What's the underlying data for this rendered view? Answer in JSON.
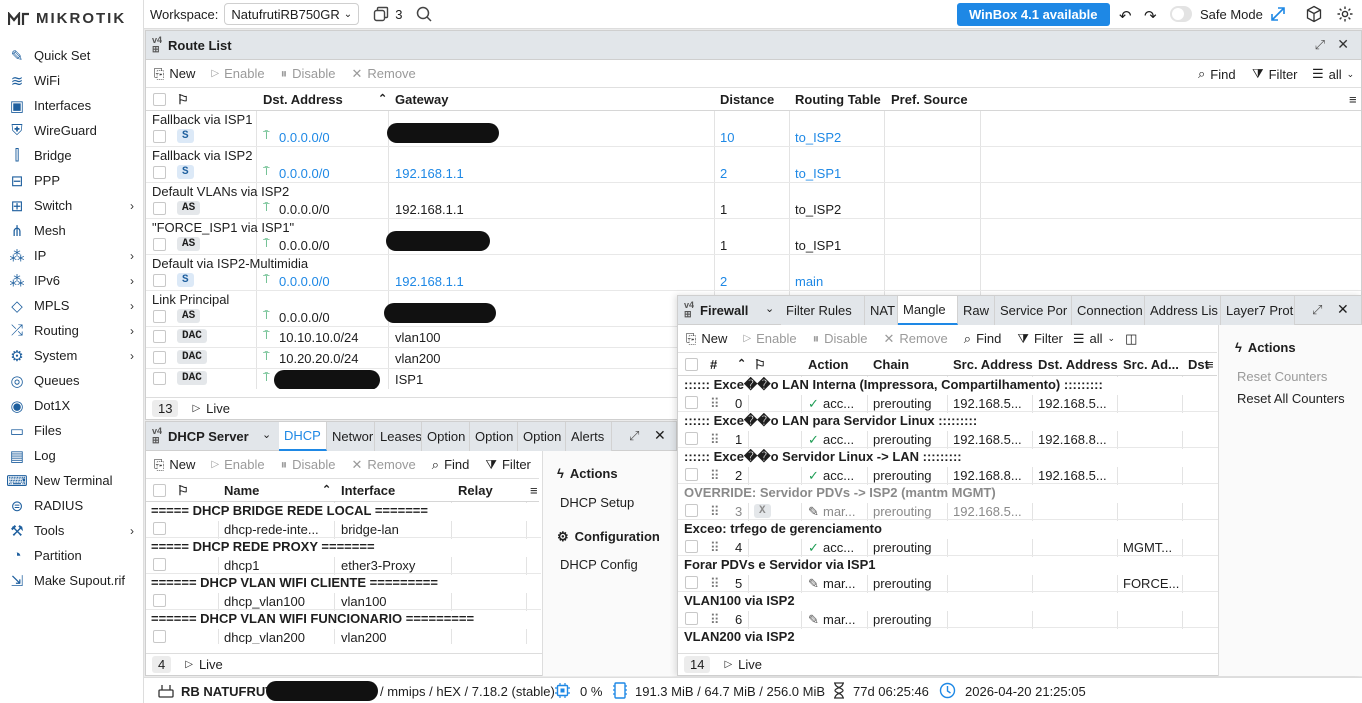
{
  "brand": {
    "logo_text": "MIKROTIK"
  },
  "sidebar": {
    "items": [
      {
        "label": "Quick Set",
        "icon": "quickset-icon",
        "arrow": false
      },
      {
        "label": "WiFi",
        "icon": "wifi-icon",
        "arrow": false
      },
      {
        "label": "Interfaces",
        "icon": "interfaces-icon",
        "arrow": false
      },
      {
        "label": "WireGuard",
        "icon": "wireguard-icon",
        "arrow": false
      },
      {
        "label": "Bridge",
        "icon": "bridge-icon",
        "arrow": false
      },
      {
        "label": "PPP",
        "icon": "ppp-icon",
        "arrow": false
      },
      {
        "label": "Switch",
        "icon": "switch-icon",
        "arrow": true
      },
      {
        "label": "Mesh",
        "icon": "mesh-icon",
        "arrow": false
      },
      {
        "label": "IP",
        "icon": "ip-icon",
        "arrow": true
      },
      {
        "label": "IPv6",
        "icon": "ipv6-icon",
        "arrow": true
      },
      {
        "label": "MPLS",
        "icon": "mpls-icon",
        "arrow": true
      },
      {
        "label": "Routing",
        "icon": "routing-icon",
        "arrow": true
      },
      {
        "label": "System",
        "icon": "system-icon",
        "arrow": true
      },
      {
        "label": "Queues",
        "icon": "queues-icon",
        "arrow": false
      },
      {
        "label": "Dot1X",
        "icon": "dot1x-icon",
        "arrow": false
      },
      {
        "label": "Files",
        "icon": "files-icon",
        "arrow": false
      },
      {
        "label": "Log",
        "icon": "log-icon",
        "arrow": false
      },
      {
        "label": "New Terminal",
        "icon": "terminal-icon",
        "arrow": false
      },
      {
        "label": "RADIUS",
        "icon": "radius-icon",
        "arrow": false
      },
      {
        "label": "Tools",
        "icon": "tools-icon",
        "arrow": true
      },
      {
        "label": "Partition",
        "icon": "partition-icon",
        "arrow": false
      },
      {
        "label": "Make Supout.rif",
        "icon": "supout-icon",
        "arrow": false
      }
    ],
    "arrow_glyph": "›"
  },
  "topbar": {
    "workspace_label": "Workspace:",
    "workspace_value": "NatufrutiRB750GR",
    "windows_count": "3",
    "update_label": "WinBox 4.1 available",
    "safe_mode_label": "Safe Mode"
  },
  "route_list": {
    "title": "Route List",
    "toolbar": {
      "new": "New",
      "enable": "Enable",
      "disable": "Disable",
      "remove": "Remove",
      "find": "Find",
      "filter": "Filter",
      "filter_mode": "all"
    },
    "columns": {
      "dst": "Dst. Address",
      "gateway": "Gateway",
      "distance": "Distance",
      "table": "Routing Table",
      "pref": "Pref. Source"
    },
    "comment_rows": [
      {
        "comment": "Fallback via ISP1",
        "flag": "S",
        "dst": "0.0.0.0/0",
        "gateway": "",
        "distance": "10",
        "table": "to_ISP2"
      },
      {
        "comment": "Fallback via ISP2",
        "flag": "S",
        "dst": "0.0.0.0/0",
        "gateway": "192.168.1.1",
        "distance": "2",
        "table": "to_ISP1"
      },
      {
        "comment": "Default VLANs via ISP2",
        "flag": "AS",
        "dst": "0.0.0.0/0",
        "gateway": "192.168.1.1",
        "distance": "1",
        "table": "to_ISP2"
      },
      {
        "comment": "\"FORCE_ISP1 via ISP1\"",
        "flag": "AS",
        "dst": "0.0.0.0/0",
        "gateway": "",
        "distance": "1",
        "table": "to_ISP1"
      },
      {
        "comment": "Default via ISP2-Multimidia",
        "flag": "S",
        "dst": "0.0.0.0/0",
        "gateway": "192.168.1.1",
        "distance": "2",
        "table": "main"
      },
      {
        "comment": "Link Principal",
        "flag": "AS",
        "dst": "0.0.0.0/0",
        "gateway": "",
        "distance": "",
        "table": ""
      }
    ],
    "plain_rows": [
      {
        "flag": "DAC",
        "dst": "10.10.10.0/24",
        "gateway": "vlan100"
      },
      {
        "flag": "DAC",
        "dst": "10.20.20.0/24",
        "gateway": "vlan200"
      },
      {
        "flag": "DAC",
        "dst": "",
        "gateway": "ISP1"
      }
    ],
    "count": "13",
    "live": "Live"
  },
  "dhcp": {
    "title": "DHCP Server",
    "tabs": [
      "DHCP",
      "Networ",
      "Leases",
      "Option",
      "Option",
      "Option",
      "Alerts"
    ],
    "toolbar": {
      "new": "New",
      "enable": "Enable",
      "disable": "Disable",
      "remove": "Remove",
      "find": "Find",
      "filter": "Filter"
    },
    "columns": {
      "name": "Name",
      "interface": "Interface",
      "relay": "Relay"
    },
    "rows": [
      {
        "group": "===== DHCP BRIDGE REDE LOCAL =======",
        "name": "dhcp-rede-inte...",
        "interface": "bridge-lan"
      },
      {
        "group": "===== DHCP REDE PROXY =======",
        "name": "dhcp1",
        "interface": "ether3-Proxy"
      },
      {
        "group": "====== DHCP VLAN WIFI CLIENTE =========",
        "name": "dhcp_vlan100",
        "interface": "vlan100"
      },
      {
        "group": "====== DHCP VLAN WIFI FUNCIONARIO =========",
        "name": "dhcp_vlan200",
        "interface": "vlan200"
      }
    ],
    "actions_title": "Actions",
    "setup": "DHCP Setup",
    "config_title": "Configuration",
    "config": "DHCP Config",
    "count": "4",
    "live": "Live"
  },
  "firewall": {
    "title": "Firewall",
    "tabs": [
      "Filter Rules",
      "NAT",
      "Mangle",
      "Raw",
      "Service Por",
      "Connection",
      "Address Lis",
      "Layer7 Prot"
    ],
    "toolbar": {
      "new": "New",
      "enable": "Enable",
      "disable": "Disable",
      "remove": "Remove",
      "find": "Find",
      "filter": "Filter",
      "filter_mode": "all"
    },
    "columns": {
      "num": "#",
      "action": "Action",
      "chain": "Chain",
      "src": "Src. Address",
      "dst": "Dst. Address",
      "srcad": "Src. Ad...",
      "dst2": "Dst"
    },
    "rows": [
      {
        "comment": ":::::: Exce��o LAN Interna (Impressora, Compartilhamento) :::::::::",
        "num": "0",
        "action": "acc...",
        "icon": "check",
        "chain": "prerouting",
        "src": "192.168.5...",
        "dst": "192.168.5...",
        "srcad": "",
        "disabled": false
      },
      {
        "comment": ":::::: Exce��o LAN para Servidor Linux :::::::::",
        "num": "1",
        "action": "acc...",
        "icon": "check",
        "chain": "prerouting",
        "src": "192.168.5...",
        "dst": "192.168.8...",
        "srcad": "",
        "disabled": false
      },
      {
        "comment": ":::::: Exce��o Servidor Linux -> LAN :::::::::",
        "num": "2",
        "action": "acc...",
        "icon": "check",
        "chain": "prerouting",
        "src": "192.168.8...",
        "dst": "192.168.5...",
        "srcad": "",
        "disabled": false
      },
      {
        "comment": "OVERRIDE: Servidor PDVs -> ISP2 (mantm MGMT)",
        "num": "3",
        "xflag": "X",
        "action": "mar...",
        "icon": "pencil",
        "chain": "prerouting",
        "src": "192.168.5...",
        "dst": "",
        "srcad": "",
        "disabled": true
      },
      {
        "comment": "Exceo: trfego de gerenciamento",
        "num": "4",
        "action": "acc...",
        "icon": "check",
        "chain": "prerouting",
        "src": "",
        "dst": "",
        "srcad": "MGMT...",
        "disabled": false
      },
      {
        "comment": "Forar PDVs e Servidor via ISP1",
        "num": "5",
        "action": "mar...",
        "icon": "pencil",
        "chain": "prerouting",
        "src": "",
        "dst": "",
        "srcad": "FORCE...",
        "disabled": false
      },
      {
        "comment": "VLAN100 via ISP2",
        "num": "6",
        "action": "mar...",
        "icon": "pencil",
        "chain": "prerouting",
        "src": "",
        "dst": "",
        "srcad": "",
        "disabled": false
      },
      {
        "comment": "VLAN200 via ISP2",
        "num": "",
        "action": "",
        "icon": "",
        "chain": "",
        "src": "",
        "dst": "",
        "srcad": "",
        "disabled": false
      }
    ],
    "actions_title": "Actions",
    "reset_counters": "Reset Counters",
    "reset_all": "Reset All Counters",
    "count": "14",
    "live": "Live"
  },
  "status": {
    "device_prefix": "RB NATUFRUTI",
    "device_suffix": "/ mmips / hEX / 7.18.2 (stable)",
    "cpu": "0 %",
    "memory": "191.3 MiB / 64.7 MiB / 256.0 MiB",
    "uptime": "77d 06:25:46",
    "datetime": "2026-04-20 21:25:05"
  },
  "colors": {
    "accent": "#1e88e5",
    "green": "#1f9d55",
    "window_title": "#e2e6ea"
  }
}
